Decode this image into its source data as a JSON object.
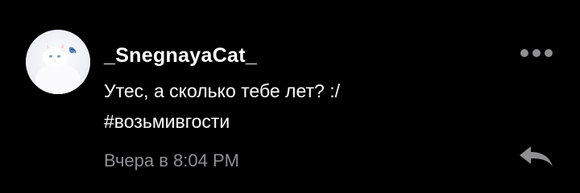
{
  "comment": {
    "username": "_SnegnayaCat_",
    "message_lines": [
      "Утес, а сколько тебе лет? :/",
      "#возьмивгости"
    ],
    "timestamp": "Вчера в 8:04 PM"
  },
  "icons": {
    "avatar": "white-cat-photo",
    "more": "more-dots-icon",
    "reply": "reply-arrow-icon"
  },
  "colors": {
    "background": "#000000",
    "text": "#ffffff",
    "secondary": "#8e8e93"
  }
}
